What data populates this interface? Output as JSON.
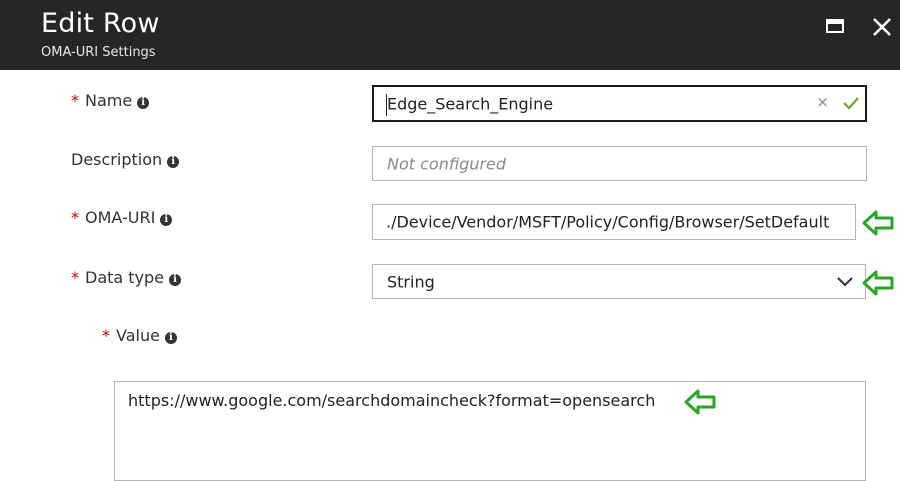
{
  "header": {
    "title": "Edit Row",
    "subtitle": "OMA-URI Settings",
    "background": "#262626"
  },
  "fields": {
    "name": {
      "label": "Name",
      "required": "*",
      "value": "Edge_Search_Engine",
      "clear_icon": "×"
    },
    "description": {
      "label": "Description",
      "placeholder": "Not configured"
    },
    "oma_uri": {
      "label": "OMA-URI",
      "required": "*",
      "value": "./Device/Vendor/MSFT/Policy/Config/Browser/SetDefault"
    },
    "data_type": {
      "label": "Data type",
      "required": "*",
      "value": "String"
    },
    "value": {
      "label": "Value",
      "required": "*",
      "value": "https://www.google.com/searchdomaincheck?format=opensearch"
    }
  },
  "icons": {
    "info": "i",
    "annotation_arrow_color": "#2aa52a",
    "check_color": "#6ba82c",
    "required_color": "#cc0000"
  }
}
